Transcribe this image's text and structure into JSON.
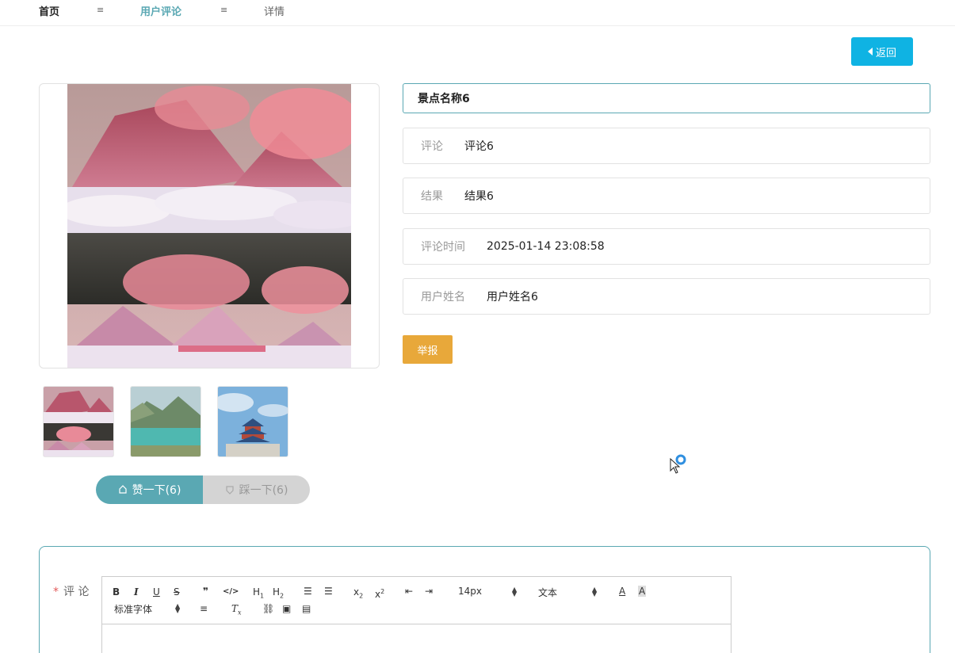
{
  "nav": {
    "home": "首页",
    "separator": "≡",
    "comments": "用户评论",
    "detail": "详情"
  },
  "back_button": {
    "label": "返回"
  },
  "detail": {
    "title": "景点名称6",
    "fields": [
      {
        "label": "评论",
        "value": "评论6"
      },
      {
        "label": "结果",
        "value": "结果6"
      },
      {
        "label": "评论时间",
        "value": "2025-01-14 23:08:58"
      },
      {
        "label": "用户姓名",
        "value": "用户姓名6"
      }
    ],
    "report_label": "举报"
  },
  "votes": {
    "like_label": "赞一下(6)",
    "dislike_label": "踩一下(6)"
  },
  "comment_form": {
    "required_mark": "*",
    "label": "评 论",
    "toolbar": {
      "size_picker": "14px",
      "header_picker": "文本",
      "font_picker": "标准字体"
    }
  },
  "colors": {
    "accent": "#5aa8b3",
    "back_button": "#0fb3e3",
    "report_button": "#e8a83a",
    "dislike": "#d4d4d4"
  }
}
